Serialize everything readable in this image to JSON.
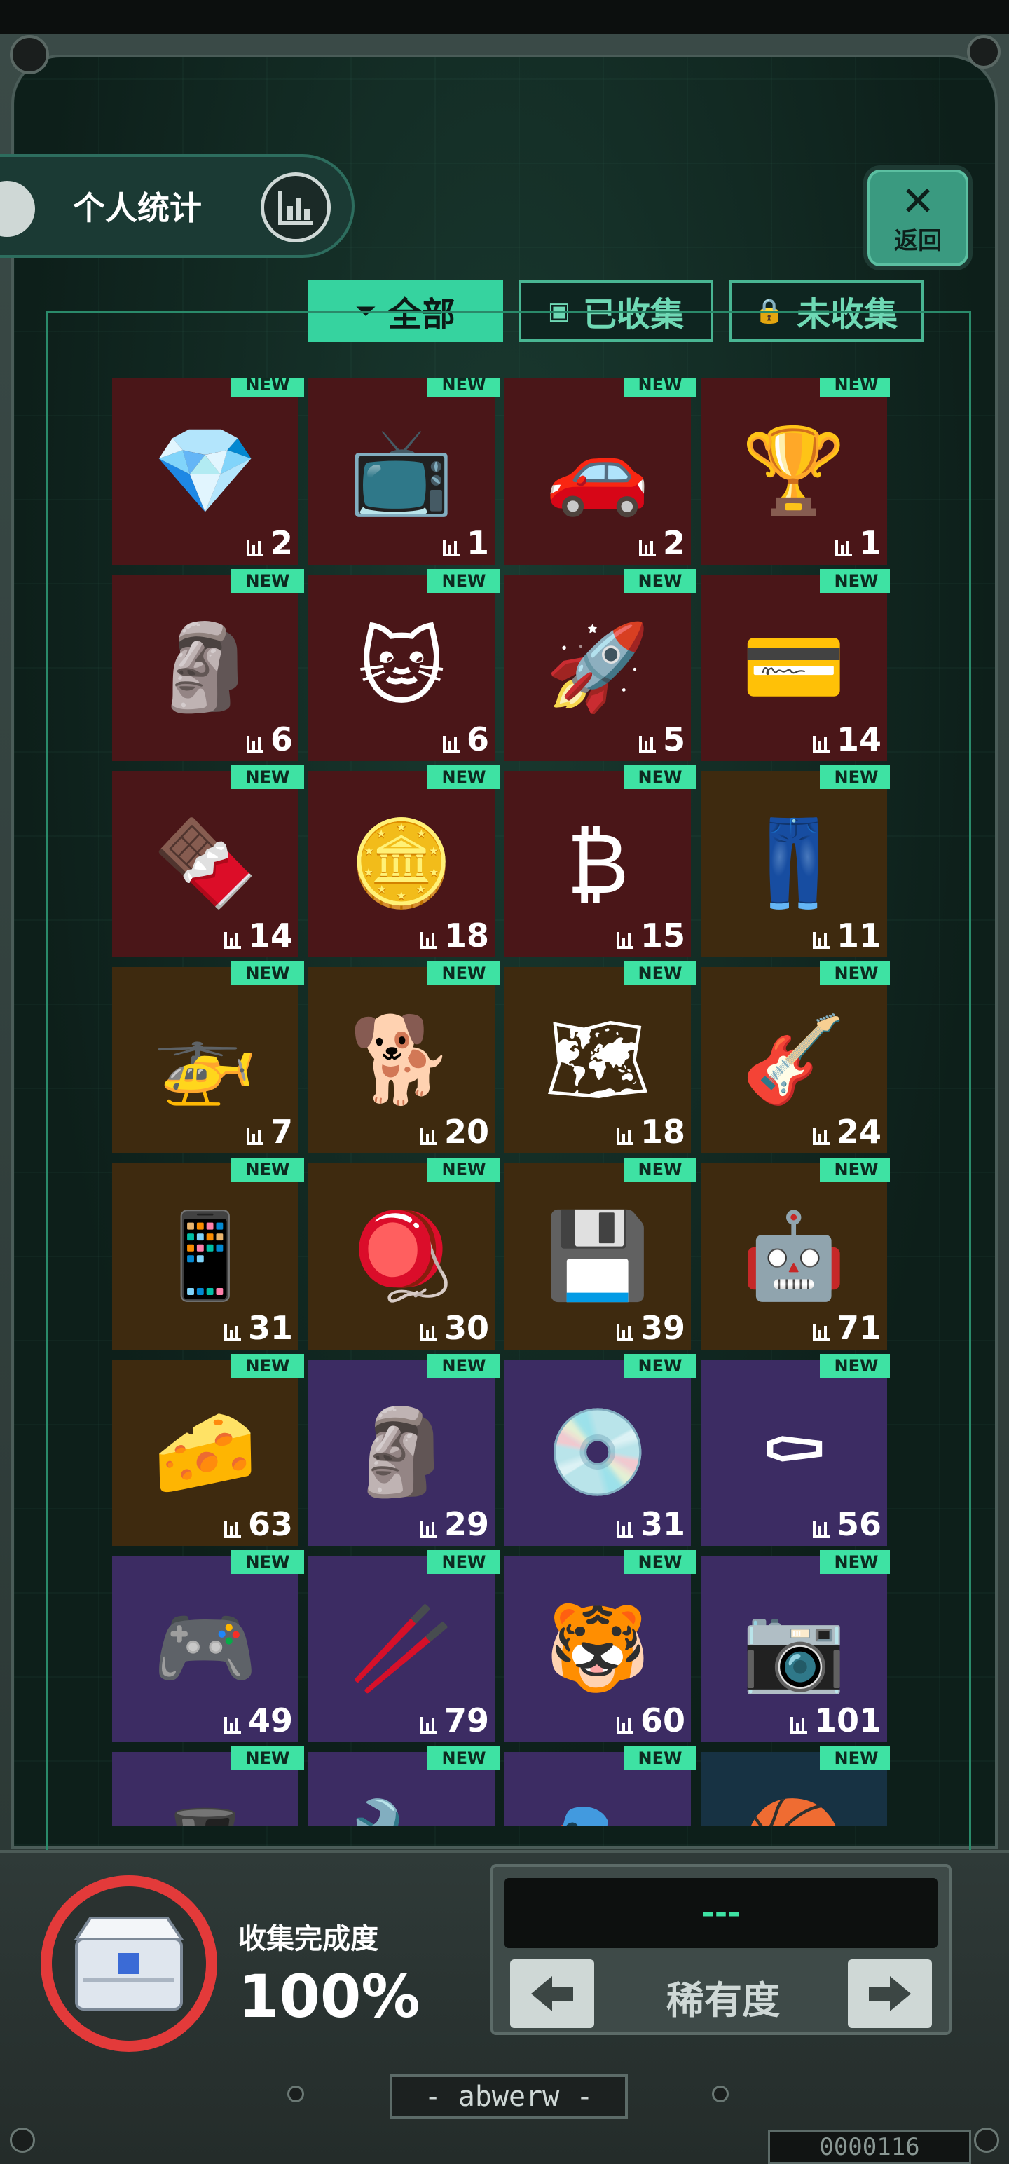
{
  "header": {
    "title": "个人统计",
    "back_label": "返回",
    "back_symbol": "✕"
  },
  "tabs": [
    {
      "label": "全部",
      "icon": "filter-icon",
      "active": true
    },
    {
      "label": "已收集",
      "icon": "box-icon",
      "active": false
    },
    {
      "label": "未收集",
      "icon": "lock-icon",
      "active": false
    }
  ],
  "badge_label": "NEW",
  "items": [
    {
      "name": "crystal",
      "count": "2",
      "rarity": "red",
      "emoji": "💎"
    },
    {
      "name": "retro-tv",
      "count": "1",
      "rarity": "red",
      "emoji": "📺"
    },
    {
      "name": "sports-car",
      "count": "2",
      "rarity": "red",
      "emoji": "🚗"
    },
    {
      "name": "goblet",
      "count": "1",
      "rarity": "red",
      "emoji": "🏆"
    },
    {
      "name": "statue",
      "count": "6",
      "rarity": "red",
      "emoji": "🗿"
    },
    {
      "name": "cat-plush",
      "count": "6",
      "rarity": "red",
      "emoji": "🐱"
    },
    {
      "name": "spaceship",
      "count": "5",
      "rarity": "red",
      "emoji": "🚀"
    },
    {
      "name": "metro-card",
      "count": "14",
      "rarity": "red",
      "emoji": "💳"
    },
    {
      "name": "chocolate-bar",
      "count": "14",
      "rarity": "red",
      "emoji": "🍫"
    },
    {
      "name": "penguin-coin",
      "count": "18",
      "rarity": "red",
      "emoji": "🪙"
    },
    {
      "name": "bitcoin",
      "count": "15",
      "rarity": "red",
      "emoji": "₿"
    },
    {
      "name": "overalls",
      "count": "11",
      "rarity": "orange",
      "emoji": "👖"
    },
    {
      "name": "drone",
      "count": "7",
      "rarity": "orange",
      "emoji": "🚁"
    },
    {
      "name": "robot-dog",
      "count": "20",
      "rarity": "orange",
      "emoji": "🐕"
    },
    {
      "name": "map",
      "count": "18",
      "rarity": "orange",
      "emoji": "🗺"
    },
    {
      "name": "guitar",
      "count": "24",
      "rarity": "orange",
      "emoji": "🎸"
    },
    {
      "name": "phone",
      "count": "31",
      "rarity": "orange",
      "emoji": "📱"
    },
    {
      "name": "spinning-top",
      "count": "30",
      "rarity": "orange",
      "emoji": "🪀"
    },
    {
      "name": "graphics-card",
      "count": "39",
      "rarity": "orange",
      "emoji": "💾"
    },
    {
      "name": "robot-head",
      "count": "71",
      "rarity": "orange",
      "emoji": "🤖"
    },
    {
      "name": "cheese",
      "count": "63",
      "rarity": "orange",
      "emoji": "🧀"
    },
    {
      "name": "terracotta-warrior",
      "count": "29",
      "rarity": "purple",
      "emoji": "🗿"
    },
    {
      "name": "hard-drive",
      "count": "31",
      "rarity": "purple",
      "emoji": "💿"
    },
    {
      "name": "pallbearers",
      "count": "56",
      "rarity": "purple",
      "emoji": "⚰"
    },
    {
      "name": "bmo",
      "count": "49",
      "rarity": "purple",
      "emoji": "🎮"
    },
    {
      "name": "staff",
      "count": "79",
      "rarity": "purple",
      "emoji": "🥢"
    },
    {
      "name": "tiger-scroll",
      "count": "60",
      "rarity": "purple",
      "emoji": "🐯"
    },
    {
      "name": "camera",
      "count": "101",
      "rarity": "purple",
      "emoji": "📷"
    },
    {
      "name": "item-29",
      "count": "",
      "rarity": "purple",
      "emoji": "🎩"
    },
    {
      "name": "item-30",
      "count": "",
      "rarity": "purple",
      "emoji": "🔧"
    },
    {
      "name": "item-31",
      "count": "",
      "rarity": "purple",
      "emoji": "🎭"
    },
    {
      "name": "basketball",
      "count": "",
      "rarity": "teal",
      "emoji": "🏀"
    }
  ],
  "progress": {
    "label": "收集完成度",
    "value": "100%"
  },
  "sort": {
    "display": "---",
    "label": "稀有度"
  },
  "plate_text": "- abwerw -",
  "counter_text": "0000116",
  "colors": {
    "accent": "#36d39f",
    "red_card": "#4a1618",
    "orange_card": "#3e2a0f",
    "purple_card": "#3c2c63",
    "ring": "#e33a3a"
  }
}
